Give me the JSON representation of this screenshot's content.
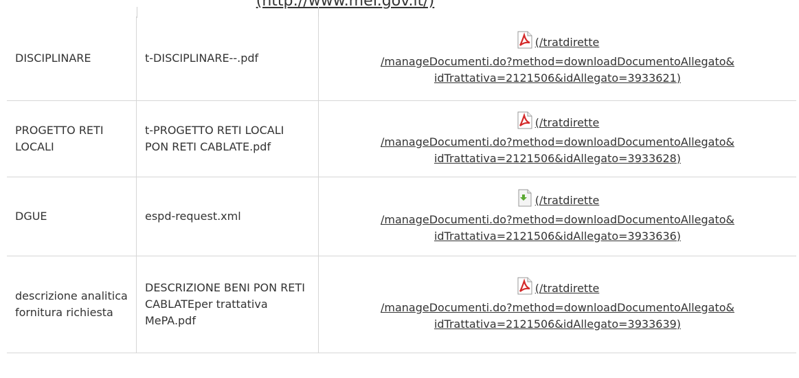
{
  "header": {
    "link_text": "(http://www.mef.gov.it/)"
  },
  "rows": [
    {
      "name": "DISCIPLINARE",
      "file": "t-DISCIPLINARE--.pdf",
      "icon": "pdf-icon",
      "link_line1": "(/tratdirette",
      "link_line2": "/manageDocumenti.do?method=downloadDocumentoAllegato&",
      "link_line3": "idTrattativa=2121506&idAllegato=3933621)"
    },
    {
      "name": "PROGETTO RETI LOCALI",
      "file": "t-PROGETTO RETI LOCALI PON RETI CABLATE.pdf",
      "icon": "pdf-icon",
      "link_line1": "(/tratdirette",
      "link_line2": "/manageDocumenti.do?method=downloadDocumentoAllegato&",
      "link_line3": "idTrattativa=2121506&idAllegato=3933628)"
    },
    {
      "name": "DGUE",
      "file": "espd-request.xml",
      "icon": "xml-file-icon",
      "link_line1": "(/tratdirette",
      "link_line2": "/manageDocumenti.do?method=downloadDocumentoAllegato&",
      "link_line3": "idTrattativa=2121506&idAllegato=3933636)"
    },
    {
      "name": "descrizione analitica fornitura richiesta",
      "file": "DESCRIZIONE BENI PON RETI CABLATEper trattativa MePA.pdf",
      "icon": "pdf-icon",
      "link_line1": "(/tratdirette",
      "link_line2": "/manageDocumenti.do?method=downloadDocumentoAllegato&",
      "link_line3": "idTrattativa=2121506&idAllegato=3933639)"
    }
  ],
  "colors": {
    "text": "#333333",
    "border": "#d6d6d6",
    "pdf_red": "#d42a2a",
    "xml_green": "#5aa832"
  }
}
